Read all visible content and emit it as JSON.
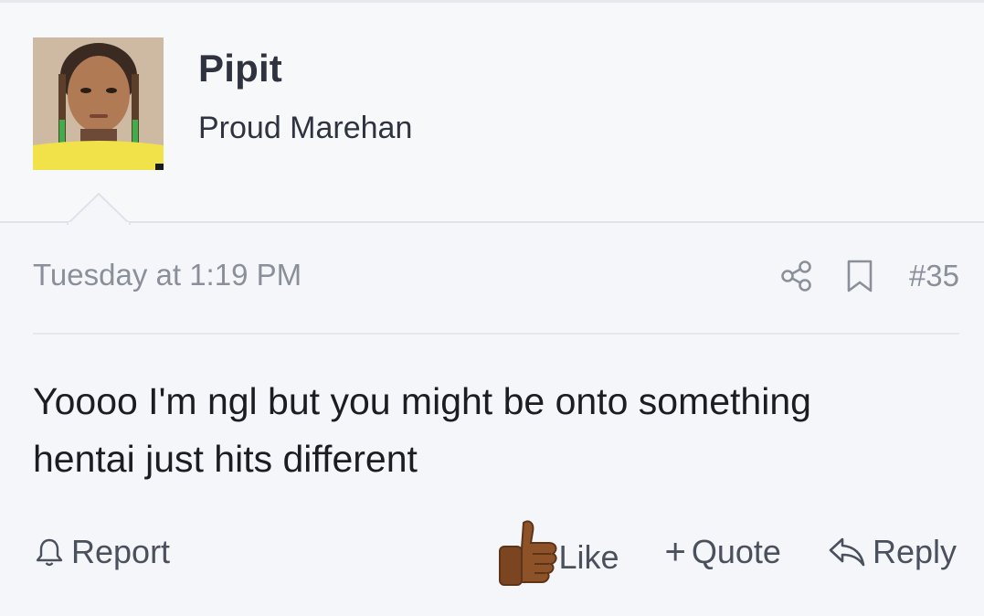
{
  "user": {
    "name": "Pipit",
    "title": "Proud Marehan"
  },
  "post": {
    "date": "Tuesday at 1:19 PM",
    "number": "#35",
    "body_line1": "Yoooo I'm ngl but you might be onto something",
    "body_line2": "hentai just hits different"
  },
  "actions": {
    "report_label": "Report",
    "like_label": "Like",
    "quote_label": "Quote",
    "reply_label": "Reply"
  },
  "icons": {
    "share": "share-icon",
    "bookmark": "bookmark-icon",
    "report": "bell-icon",
    "like": "thumbs-up-emoji",
    "quote": "plus-icon",
    "reply": "reply-arrow-icon"
  },
  "colors": {
    "background": "#f5f6fa",
    "header_background": "#f7f8fa",
    "text": "#1b1d22",
    "muted_text": "#8a8f99",
    "action_text": "#4a505c"
  }
}
